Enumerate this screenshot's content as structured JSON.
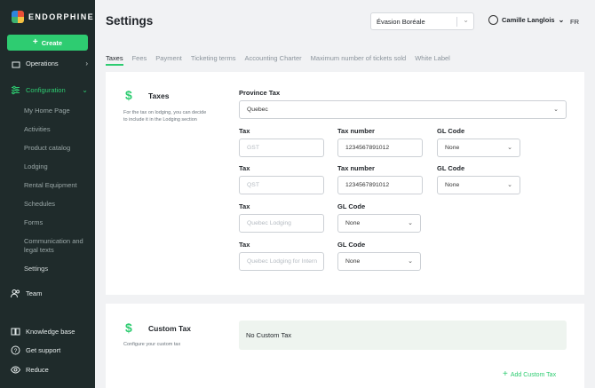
{
  "brand": {
    "name": "ENDORPHINE"
  },
  "sidebar": {
    "create_label": "Create",
    "operations_label": "Operations",
    "configuration_label": "Configuration",
    "sub_items": [
      "My Home Page",
      "Activities",
      "Product catalog",
      "Lodging",
      "Rental Equipment",
      "Schedules",
      "Forms",
      "Communication and",
      "legal texts",
      "Settings"
    ],
    "team_label": "Team",
    "bottom": [
      "Knowledge base",
      "Get support",
      "Reduce"
    ]
  },
  "header": {
    "title": "Settings",
    "organization": "Évasion Boréale",
    "user_name": "Camille Langlois",
    "language": "FR"
  },
  "tabs": [
    "Taxes",
    "Fees",
    "Payment",
    "Ticketing terms",
    "Accounting Charter",
    "Maximum number of tickets sold",
    "White Label"
  ],
  "taxes": {
    "title": "Taxes",
    "description_line1": "For the tax on lodging, you can decide",
    "description_line2": "to include it in the Lodging section",
    "province_label": "Province Tax",
    "province_value": "Quebec",
    "labels": {
      "tax": "Tax",
      "tax_number": "Tax number",
      "gl_code": "GL Code"
    },
    "rows": [
      {
        "placeholder": "GST",
        "number": "1234567891012",
        "gl": "None"
      },
      {
        "placeholder": "QST",
        "number": "1234567891012",
        "gl": "None"
      },
      {
        "placeholder": "Quebec Lodging",
        "gl": "None"
      },
      {
        "placeholder": "Quebec Lodging for Intern",
        "gl": "None"
      }
    ]
  },
  "custom_tax": {
    "title": "Custom Tax",
    "description": "Configure your custom tax",
    "empty_text": "No Custom Tax",
    "add_label": "Add Custom Tax"
  },
  "colors": {
    "accent": "#2ecc71",
    "sidebar_bg": "#1f2b2b"
  }
}
